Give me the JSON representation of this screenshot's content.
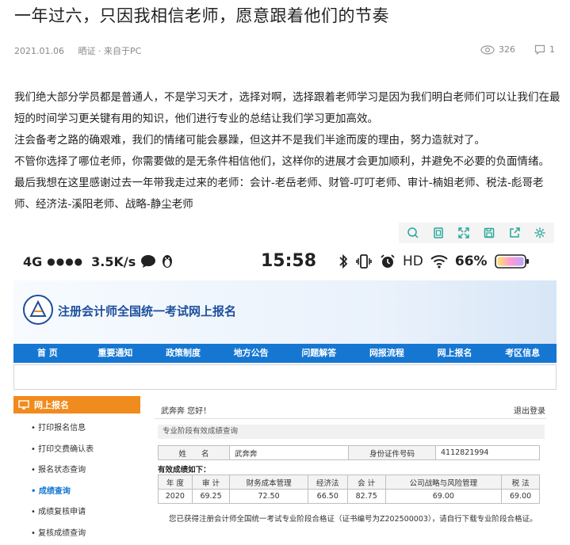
{
  "article": {
    "title": "一年过六，只因我相信老师，愿意跟着他们的节奏",
    "date": "2021.01.06",
    "author_source": "晒证 · 来自于PC",
    "views": "326",
    "comments": "1",
    "paragraphs": [
      "我们绝大部分学员都是普通人，不是学习天才，选择对啊，选择跟着老师学习是因为我们明白老师们可以让我们在最短的时间学习更关键有用的知识，他们进行专业的总结让我们学习更加高效。",
      "注会备考之路的确艰难，我们的情绪可能会暴躁，但这并不是我们半途而废的理由，努力造就对了。",
      "不管你选择了哪位老师，你需要做的是无条件相信他们，这样你的进展才会更加顺利，并避免不必要的负面情绪。",
      "最后我想在这里感谢过去一年带我走过来的老师：会计-老岳老师、财管-叮叮老师、审计-楠姐老师、税法-彪哥老师、经济法-溪阳老师、战略-静尘老师"
    ]
  },
  "toolbar": {
    "icons": [
      "search-icon",
      "copy-icon",
      "expand-icon",
      "save-icon",
      "share-icon",
      "settings-icon"
    ]
  },
  "screenshot": {
    "statusbar": {
      "network": "4G",
      "signal_dots": "●●●●",
      "speed": "3.5K/s",
      "time": "15:58",
      "hd": "HD",
      "battery": "66%"
    },
    "site_title": "注册会计师全国统一考试网上报名",
    "nav": [
      "首 页",
      "重要通知",
      "政策制度",
      "地方公告",
      "问题解答",
      "网报流程",
      "网上报名",
      "考区信息"
    ],
    "sidebar": {
      "header": "网上报名",
      "items": [
        "• 打印报名信息",
        "• 打印交费确认表",
        "• 报名状态查询",
        "• 成绩查询",
        "• 成绩复核申请",
        "• 复核成绩查询"
      ],
      "active_index": 3
    },
    "main": {
      "greeting": "武奔奔 您好！",
      "logout": "退出登录",
      "section_title": "专业阶段有效成绩查询",
      "name_label": "姓　　名",
      "name_value": "武奔奔",
      "id_label": "身份证件号码",
      "id_value": "4112821994",
      "effective_label": "有效成绩如下：",
      "score_headers": [
        "年 度",
        "审 计",
        "财务成本管理",
        "经济法",
        "会 计",
        "公司战略与风险管理",
        "税 法"
      ],
      "score_row": [
        "2020",
        "69.25",
        "72.50",
        "66.50",
        "82.75",
        "69.00",
        "69.00"
      ],
      "notice": "您已获得注册会计师全国统一考试专业阶段合格证（证书编号为Z202500003），请自行下载专业阶段合格证。"
    }
  },
  "colors": {
    "nav_blue": "#1677d2",
    "sidebar_orange": "#f08b1d",
    "logo_blue": "#1e4f9c"
  }
}
